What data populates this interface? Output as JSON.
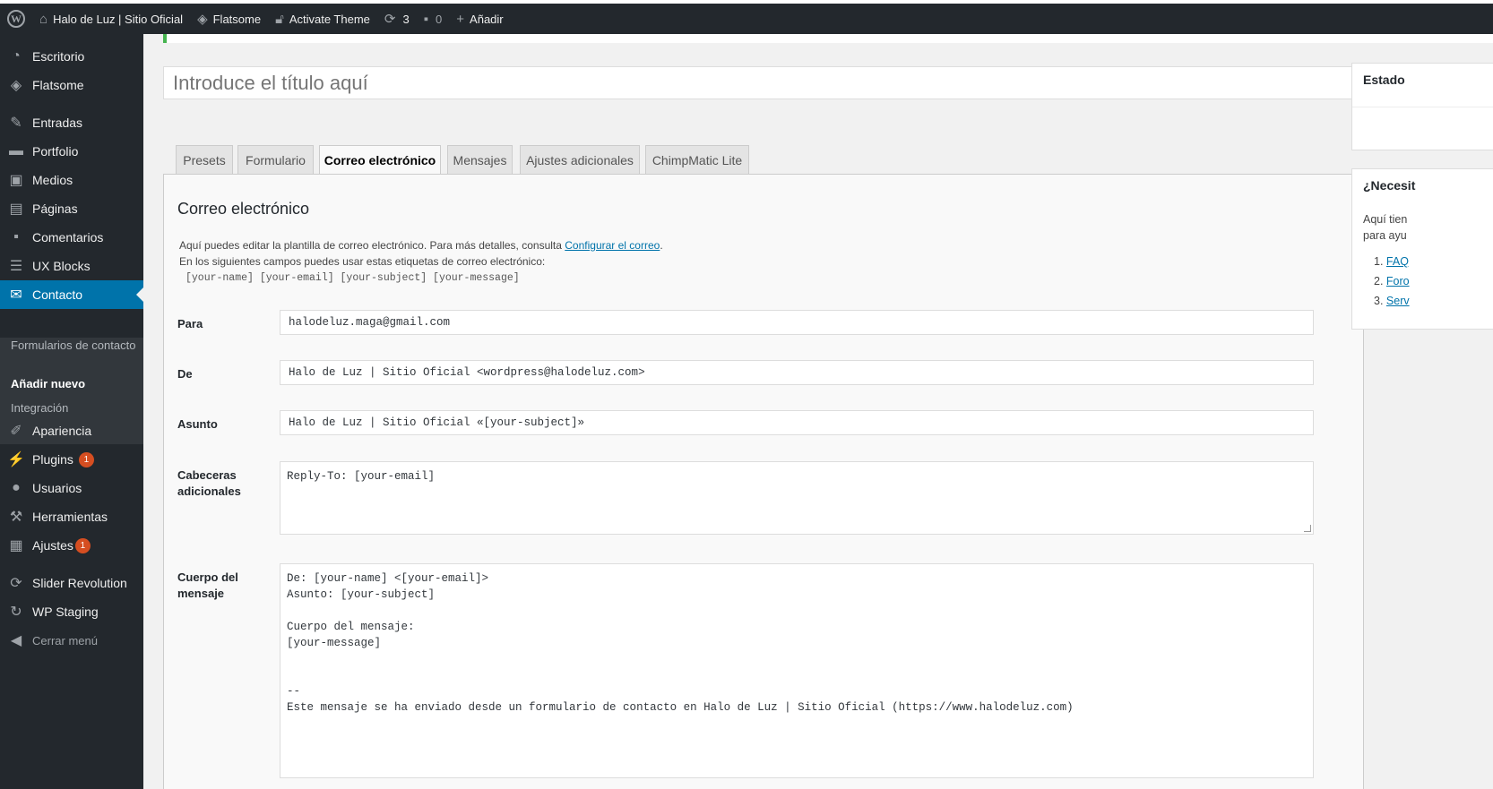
{
  "admin_bar": {
    "site_name": "Halo de Luz | Sitio Oficial",
    "theme": "Flatsome",
    "activate": "Activate Theme",
    "updates_count": "3",
    "comments_count": "0",
    "add_new": "Añadir"
  },
  "sidebar": {
    "items": [
      {
        "label": "Escritorio",
        "icon": "dashboard-icon"
      },
      {
        "label": "Flatsome",
        "icon": "flatsome-icon"
      },
      {
        "label": "Entradas",
        "icon": "pin-icon"
      },
      {
        "label": "Portfolio",
        "icon": "folder-icon"
      },
      {
        "label": "Medios",
        "icon": "media-icon"
      },
      {
        "label": "Páginas",
        "icon": "pages-icon"
      },
      {
        "label": "Comentarios",
        "icon": "comment-icon"
      },
      {
        "label": "UX Blocks",
        "icon": "blocks-icon"
      },
      {
        "label": "Contacto",
        "icon": "mail-icon"
      },
      {
        "label": "Apariencia",
        "icon": "brush-icon"
      },
      {
        "label": "Plugins",
        "icon": "plugin-icon",
        "badge": "1"
      },
      {
        "label": "Usuarios",
        "icon": "user-icon"
      },
      {
        "label": "Herramientas",
        "icon": "wrench-icon"
      },
      {
        "label": "Ajustes",
        "icon": "settings-icon",
        "badge": "1"
      },
      {
        "label": "Slider Revolution",
        "icon": "refresh-icon"
      },
      {
        "label": "WP Staging",
        "icon": "sync-icon"
      },
      {
        "label": "Cerrar menú",
        "icon": "collapse-icon"
      }
    ],
    "submenu": {
      "forms": "Formularios de contacto",
      "add_new": "Añadir nuevo",
      "integration": "Integración"
    }
  },
  "title_placeholder": "Introduce el título aquí",
  "tabs": [
    "Presets",
    "Formulario",
    "Correo electrónico",
    "Mensajes",
    "Ajustes adicionales",
    "ChimpMatic Lite"
  ],
  "mail": {
    "heading": "Correo electrónico",
    "desc1_before": "Aquí puedes editar la plantilla de correo electrónico. Para más detalles, consulta ",
    "desc1_link": "Configurar el correo",
    "desc1_after": ".",
    "desc2": "En los siguientes campos puedes usar estas etiquetas de correo electrónico:",
    "tags": "[your-name] [your-email] [your-subject] [your-message]",
    "to_label": "Para",
    "to_value": "halodeluz.maga@gmail.com",
    "from_label": "De",
    "from_value": "Halo de Luz | Sitio Oficial <wordpress@halodeluz.com>",
    "subject_label": "Asunto",
    "subject_value": "Halo de Luz | Sitio Oficial «[your-subject]»",
    "headers_label": "Cabeceras adicionales",
    "headers_value": "Reply-To: [your-email]",
    "body_label": "Cuerpo del mensaje",
    "body_line1": "De: [your-name] <[your-email]>",
    "body_line2": "Asunto: [your-subject]",
    "body_line3": "Cuerpo del mensaje:",
    "body_line4": "[your-message]",
    "body_line5": "--",
    "body_line6": "Este mensaje se ha enviado desde un formulario de contacto en Halo de Luz | Sitio Oficial (https://www.halodeluz.com)"
  },
  "right": {
    "status_title": "Estado",
    "help_title": "¿Necesit",
    "help_text1": "Aquí tien",
    "help_text2": "para ayu",
    "links": [
      "FAQ",
      "Foro",
      "Serv"
    ]
  }
}
